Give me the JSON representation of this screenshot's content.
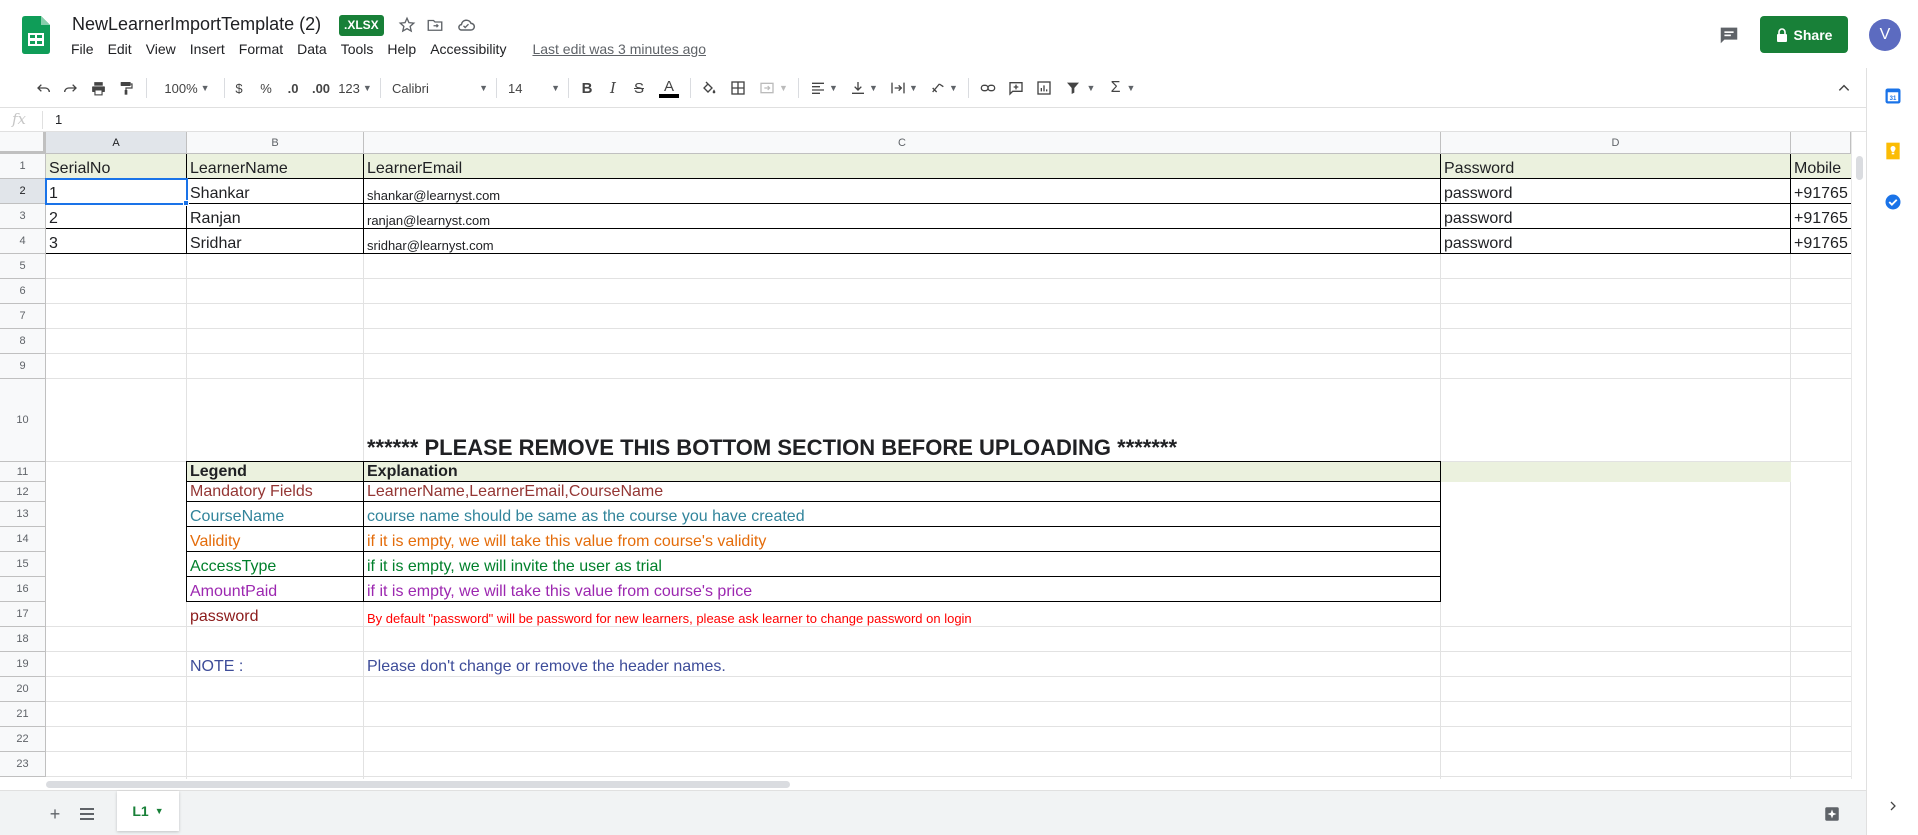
{
  "app": {
    "doc_title": "NewLearnerImportTemplate (2)",
    "file_badge": ".XLSX",
    "menus": [
      "File",
      "Edit",
      "View",
      "Insert",
      "Format",
      "Data",
      "Tools",
      "Help",
      "Accessibility"
    ],
    "last_edit": "Last edit was 3 minutes ago",
    "share_label": "Share",
    "avatar_letter": "V",
    "colors": {
      "brand_green": "#188038",
      "selection_blue": "#1a73e8",
      "header_fill": "#ebf1de"
    }
  },
  "toolbar": {
    "zoom": "100%",
    "currency": "$",
    "percent": "%",
    "decrease_decimals": ".0",
    "increase_decimals": ".00",
    "more_formats": "123",
    "font": "Calibri",
    "font_size": "14"
  },
  "formula_bar": {
    "fx_label": "fx",
    "value": "1"
  },
  "columns": [
    "A",
    "B",
    "C",
    "D"
  ],
  "rows": [
    "1",
    "2",
    "3",
    "4",
    "5",
    "6",
    "7",
    "8",
    "9",
    "10",
    "11",
    "12",
    "13",
    "14",
    "15",
    "16",
    "17",
    "18",
    "19",
    "20",
    "21",
    "22",
    "23"
  ],
  "table": {
    "headers": [
      "SerialNo",
      "LearnerName",
      "LearnerEmail",
      "Password",
      "Mobile"
    ],
    "learners": [
      {
        "serial": "1",
        "name": "Shankar",
        "email": "shankar@learnyst.com",
        "password": "password",
        "mobile": "+91765"
      },
      {
        "serial": "2",
        "name": "Ranjan",
        "email": "ranjan@learnyst.com",
        "password": "password",
        "mobile": "+91765"
      },
      {
        "serial": "3",
        "name": "Sridhar",
        "email": "sridhar@learnyst.com",
        "password": "password",
        "mobile": "+91765"
      }
    ]
  },
  "notice": "****** PLEASE REMOVE THIS BOTTOM SECTION BEFORE UPLOADING *******",
  "legend": {
    "header_legend": "Legend",
    "header_explanation": "Explanation",
    "items": [
      {
        "label": "Mandatory Fields",
        "text": "LearnerName,LearnerEmail,CourseName",
        "color": "#943634"
      },
      {
        "label": "CourseName",
        "text": "course name should be same as the course you have created",
        "color": "#31849b"
      },
      {
        "label": "Validity",
        "text": "if it is empty, we will take this value from course's validity",
        "color": "#e46c0a"
      },
      {
        "label": "AccessType",
        "text": "if it is empty, we will invite the user as trial",
        "color": "#00802b"
      },
      {
        "label": "AmountPaid",
        "text": "if it is empty, we will take this value from course's price",
        "color": "#9c27b0"
      }
    ],
    "password_label": "password",
    "password_text": "By default \"password\" will be password for new learners, please ask learner to change password on login",
    "password_label_color": "#8b1a1a",
    "password_text_color": "#ff0000"
  },
  "note": {
    "label": "NOTE :",
    "text": "Please don't change or remove the header names.",
    "color": "#3d4c99"
  },
  "sheet_tabs": [
    {
      "name": "L1"
    }
  ]
}
